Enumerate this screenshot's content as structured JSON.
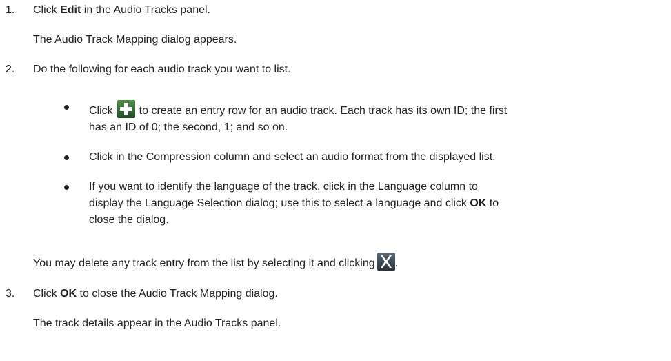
{
  "steps": [
    {
      "number": "1.",
      "pre": "Click ",
      "bold": "Edit",
      "post": " in the Audio Tracks panel.",
      "result": "The Audio Track Mapping dialog appears."
    },
    {
      "number": "2.",
      "text": "Do the following for each audio track you want to list.",
      "bullets": [
        {
          "pre": "Click",
          "icon": "add-icon",
          "post": "to create an entry row for an audio track. Each track has its own ID; the first",
          "line2": "has an ID of 0; the second, 1; and so on."
        },
        {
          "text": "Click in the Compression column and select an audio format from the displayed list."
        },
        {
          "line1": "If you want to identify the language of the track, click in the Language column to",
          "line2": "display the Language Selection dialog; use this to select a language and click ",
          "line2_bold": "OK",
          "line2_post": " to",
          "line3": "close the dialog."
        }
      ],
      "note_pre": "You may delete any track entry from the list by selecting it and clicking",
      "note_icon": "delete-icon",
      "note_post": "."
    },
    {
      "number": "3.",
      "pre": "Click ",
      "bold": "OK",
      "post": " to close the Audio Track Mapping dialog.",
      "result": "The track details appear in the Audio Tracks panel."
    }
  ],
  "colors": {
    "text": "#222222",
    "plus_icon_bg": "#2f6b34",
    "x_icon_bg": "#3d4a55"
  }
}
